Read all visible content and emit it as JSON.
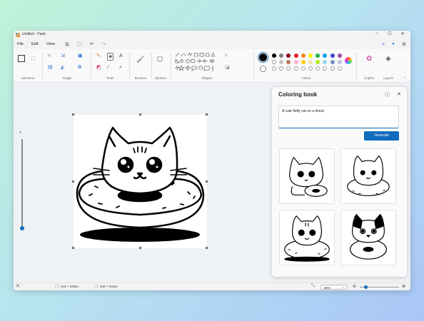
{
  "window": {
    "title": "Untitled - Paint"
  },
  "menu": {
    "items": [
      "File",
      "Edit",
      "View"
    ]
  },
  "ribbon": {
    "groups": [
      "Selection",
      "Image",
      "Tools",
      "Brushes",
      "Stickers",
      "Shapes",
      "Colors",
      "Copilot",
      "Layers"
    ]
  },
  "colors": {
    "row1": [
      "#000000",
      "#7f7f7f",
      "#880015",
      "#ed1c24",
      "#ff7f27",
      "#fff200",
      "#22b14c",
      "#00a2e8",
      "#3f48cc",
      "#a349a4"
    ],
    "row2": [
      "#ffffff",
      "#c3c3c3",
      "#b97a57",
      "#ffaec9",
      "#ffc90e",
      "#efe4b0",
      "#b5e61d",
      "#99d9ea",
      "#7092be",
      "#c8bfe7"
    ]
  },
  "statusbar": {
    "canvas_size": "646 × 646px",
    "selection_size": "646 × 646px",
    "zoom": "69%"
  },
  "panel": {
    "title": "Coloring book",
    "prompt": "A cute fluffy cat on a donut",
    "generate_label": "Generate"
  },
  "icons": {
    "app": "paint-icon",
    "minimize": "minimize-icon",
    "maximize": "maximize-icon",
    "close": "close-icon",
    "save": "save-icon",
    "undo": "undo-icon",
    "redo": "redo-icon",
    "share": "share-icon",
    "account": "account-icon",
    "settings": "gear-icon",
    "info": "info-icon",
    "panel_close": "close-icon"
  }
}
